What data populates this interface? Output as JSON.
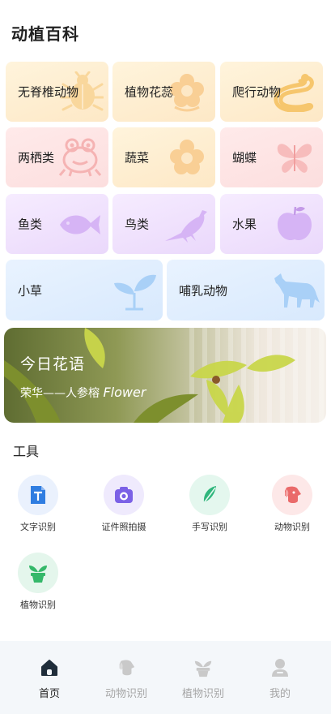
{
  "header": {
    "title": "动植百科"
  },
  "categories": [
    {
      "label": "无脊椎动物",
      "icon": "beetle-icon"
    },
    {
      "label": "植物花蕊",
      "icon": "flower-icon"
    },
    {
      "label": "爬行动物",
      "icon": "snake-icon"
    },
    {
      "label": "两栖类",
      "icon": "frog-icon"
    },
    {
      "label": "蔬菜",
      "icon": "vegetable-flower-icon"
    },
    {
      "label": "蝴蝶",
      "icon": "butterfly-icon"
    },
    {
      "label": "鱼类",
      "icon": "fish-icon"
    },
    {
      "label": "鸟类",
      "icon": "bird-icon"
    },
    {
      "label": "水果",
      "icon": "apple-icon"
    },
    {
      "label": "小草",
      "icon": "sprout-icon"
    },
    {
      "label": "哺乳动物",
      "icon": "fox-icon"
    }
  ],
  "banner": {
    "title": "今日花语",
    "subtitle": "荣华——人参榕",
    "subtitle_latin": "Flower"
  },
  "tools": {
    "title": "工具",
    "items": [
      {
        "label": "文字识别",
        "icon": "text-recognition-icon",
        "color": "#2f7de1"
      },
      {
        "label": "证件照拍摄",
        "icon": "camera-icon",
        "color": "#7b61e6"
      },
      {
        "label": "手写识别",
        "icon": "feather-pen-icon",
        "color": "#2fb67c"
      },
      {
        "label": "动物识别",
        "icon": "dog-icon",
        "color": "#ea6a6a"
      },
      {
        "label": "植物识别",
        "icon": "potted-plant-icon",
        "color": "#35b86a"
      }
    ]
  },
  "tabbar": {
    "items": [
      {
        "label": "首页",
        "icon": "home-icon",
        "active": true
      },
      {
        "label": "动物识别",
        "icon": "dog-icon",
        "active": false
      },
      {
        "label": "植物识别",
        "icon": "plant-icon",
        "active": false
      },
      {
        "label": "我的",
        "icon": "user-icon",
        "active": false
      }
    ]
  }
}
